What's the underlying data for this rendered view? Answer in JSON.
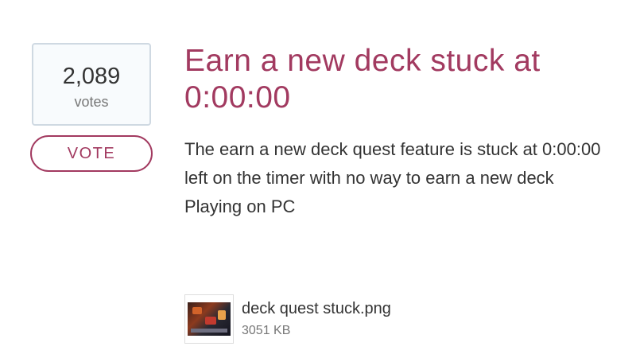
{
  "vote": {
    "count": "2,089",
    "count_label": "votes",
    "button_label": "VOTE"
  },
  "idea": {
    "title": "Earn a new deck stuck at 0:00:00",
    "description_lines": [
      "The earn a new deck quest feature is stuck at 0:00:00 left on the timer with no way to earn a new deck",
      "Playing on PC"
    ]
  },
  "attachment": {
    "file_name": "deck quest stuck.png",
    "file_size": "3051 KB",
    "icon": "image-thumbnail-icon"
  },
  "colors": {
    "accent": "#a23a60",
    "text": "#333333",
    "muted": "#777777",
    "vote_box_border": "#cfd9e2"
  }
}
